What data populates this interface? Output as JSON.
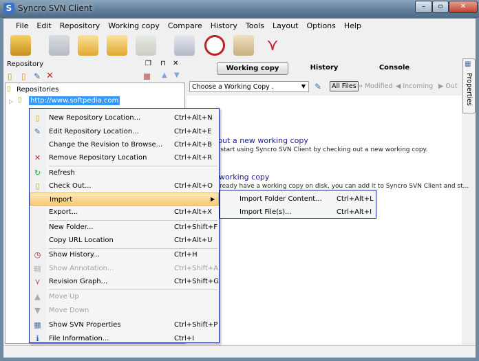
{
  "window": {
    "title": "Syncro SVN Client",
    "app_icon": "S"
  },
  "menubar": [
    "File",
    "Edit",
    "Repository",
    "Working copy",
    "Compare",
    "History",
    "Tools",
    "Layout",
    "Options",
    "Help"
  ],
  "repository_panel": {
    "title": "Repository",
    "root": "Repositories",
    "url": "http://www.softpedia.com"
  },
  "tabs": [
    "Working copy",
    "History",
    "Console"
  ],
  "filter": {
    "select_value": "Choose a Working Copy .",
    "all_files": "All Files",
    "modified": "Modified",
    "incoming": "Incoming",
    "outgoing": "Out"
  },
  "side_tab": "Properties",
  "welcome": {
    "checkout_title": "Checkout a new working copy",
    "checkout_desc": "You can start using Syncro SVN Client by checking out a new working copy.",
    "add_title": "Add a working copy",
    "add_desc": "If you already have a working copy on disk, you can add it to Syncro SVN Client and st..."
  },
  "context_menu": [
    {
      "label": "New Repository Location...",
      "shortcut": "Ctrl+Alt+N",
      "icon": "new-repository-icon",
      "glyph": "▯",
      "color": "#c8a020"
    },
    {
      "label": "Edit Repository Location...",
      "shortcut": "Ctrl+Alt+E",
      "icon": "edit-icon",
      "glyph": "✎",
      "color": "#3a6ab0"
    },
    {
      "label": "Change the Revision to Browse...",
      "shortcut": "Ctrl+Alt+B"
    },
    {
      "label": "Remove Repository Location",
      "shortcut": "Ctrl+Alt+R",
      "icon": "remove-icon",
      "glyph": "✕",
      "color": "#d02020",
      "sep": true
    },
    {
      "label": "Refresh",
      "shortcut": "",
      "icon": "refresh-icon",
      "glyph": "↻",
      "color": "#20a020"
    },
    {
      "label": "Check Out...",
      "shortcut": "Ctrl+Alt+O",
      "icon": "checkout-icon",
      "glyph": "▯",
      "color": "#c8a020"
    },
    {
      "label": "Import",
      "shortcut": "",
      "submenu": true,
      "highlighted": true
    },
    {
      "label": "Export...",
      "shortcut": "Ctrl+Alt+X",
      "sep": true
    },
    {
      "label": "New Folder...",
      "shortcut": "Ctrl+Shift+F"
    },
    {
      "label": "Copy URL Location",
      "shortcut": "Ctrl+Alt+U",
      "sep": true
    },
    {
      "label": "Show History...",
      "shortcut": "Ctrl+H",
      "icon": "history-icon",
      "glyph": "◷",
      "color": "#c02020"
    },
    {
      "label": "Show Annotation...",
      "shortcut": "Ctrl+Shift+A",
      "icon": "annotation-icon",
      "glyph": "▤",
      "color": "#aaa",
      "disabled": true
    },
    {
      "label": "Revision Graph...",
      "shortcut": "Ctrl+Shift+G",
      "icon": "revision-graph-icon",
      "glyph": "⋎",
      "color": "#d02040",
      "sep": true
    },
    {
      "label": "Move Up",
      "shortcut": "",
      "icon": "arrow-up-icon",
      "glyph": "▲",
      "color": "#aaa",
      "disabled": true
    },
    {
      "label": "Move Down",
      "shortcut": "",
      "icon": "arrow-down-icon",
      "glyph": "▼",
      "color": "#aaa",
      "disabled": true
    },
    {
      "label": "Show SVN Properties",
      "shortcut": "Ctrl+Shift+P",
      "icon": "properties-icon",
      "glyph": "▦",
      "color": "#5070a0"
    },
    {
      "label": "File Information...",
      "shortcut": "Ctrl+I",
      "icon": "info-icon",
      "glyph": "ℹ",
      "color": "#1a5ac8"
    }
  ],
  "submenu": [
    {
      "label": "Import Folder Content...",
      "shortcut": "Ctrl+Alt+L"
    },
    {
      "label": "Import File(s)...",
      "shortcut": "Ctrl+Alt+I"
    }
  ]
}
